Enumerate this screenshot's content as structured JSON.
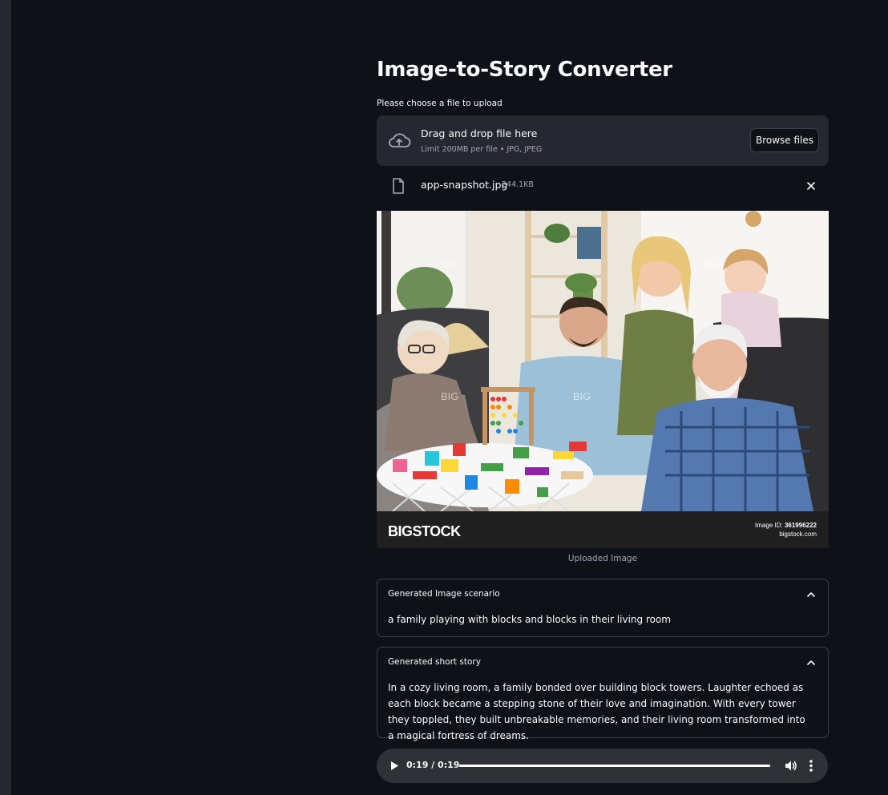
{
  "app": {
    "title": "Image-to-Story Converter"
  },
  "uploader": {
    "label": "Please choose a file to upload",
    "drop_title": "Drag and drop file here",
    "limit_text": "Limit 200MB per file • JPG, JPEG",
    "browse_label": "Browse files",
    "icon": "cloud-upload-icon"
  },
  "file": {
    "name": "app-snapshot.jpg",
    "size": "244.1KB",
    "icon": "file-icon"
  },
  "image": {
    "caption": "Uploaded Image",
    "watermark": "BIG",
    "brand": "BIGSTOCK",
    "id_label": "Image ID:",
    "id_value": "361996222",
    "site": "bigstock.com"
  },
  "scenario": {
    "title": "Generated Image scenario",
    "text": "a family playing with blocks and blocks in their living room"
  },
  "story": {
    "title": "Generated short story",
    "text": "In a cozy living room, a family bonded over building block towers. Laughter echoed as each block became a stepping stone of their love and imagination. With every tower they toppled, they built unbreakable memories, and their living room transformed into a magical fortress of dreams."
  },
  "audio": {
    "time": "0:19 / 0:19",
    "progress": 1.0
  },
  "colors": {
    "background": "#0e1117",
    "sidebar_strip": "#262730",
    "panel": "#262730",
    "border": "#3d4049",
    "text": "#fafafa",
    "muted_text": "#a3a8b8"
  }
}
